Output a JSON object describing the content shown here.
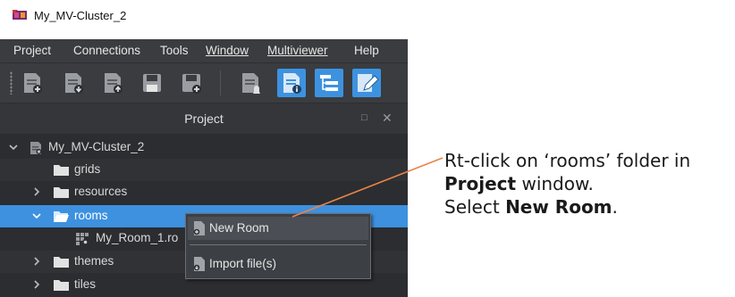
{
  "window": {
    "title": "My_MV-Cluster_2"
  },
  "menubar": {
    "items": [
      {
        "label": "Project"
      },
      {
        "label": "Connections"
      },
      {
        "label": "Tools"
      },
      {
        "label": "Window"
      },
      {
        "label": "Multiviewer"
      },
      {
        "label": "Help"
      }
    ]
  },
  "toolbar": {
    "buttons": [
      {
        "icon": "new-document-icon",
        "active": false
      },
      {
        "icon": "download-document-icon",
        "active": false
      },
      {
        "icon": "upload-document-icon",
        "active": false
      },
      {
        "icon": "save-icon",
        "active": false
      },
      {
        "icon": "save-add-icon",
        "active": false
      },
      {
        "icon": "notification-document-icon",
        "active": false
      },
      {
        "icon": "info-document-icon",
        "active": true
      },
      {
        "icon": "tree-view-icon",
        "active": true
      },
      {
        "icon": "edit-pencil-icon",
        "active": true
      }
    ]
  },
  "panel": {
    "title": "Project",
    "float_icon": "□",
    "close_icon": "✕"
  },
  "tree": {
    "rows": [
      {
        "label": "My_MV-Cluster_2",
        "type": "project",
        "expanded": true
      },
      {
        "label": "grids",
        "type": "folder"
      },
      {
        "label": "resources",
        "type": "folder",
        "expanded": false
      },
      {
        "label": "rooms",
        "type": "folder",
        "expanded": true,
        "selected": true
      },
      {
        "label": "My_Room_1.ro",
        "type": "room"
      },
      {
        "label": "themes",
        "type": "folder",
        "expanded": false
      },
      {
        "label": "tiles",
        "type": "folder",
        "expanded": false
      }
    ]
  },
  "context_menu": {
    "items": [
      {
        "label": "New Room"
      },
      {
        "label": "Import file(s)"
      }
    ]
  },
  "annotation": {
    "line1": "Rt-click on ‘rooms’ folder in",
    "line2_bold": "Project",
    "line2_rest": " window.",
    "line3_pre": "Select ",
    "line3_bold": "New Room",
    "line3_post": "."
  },
  "colors": {
    "selection": "#3d91df",
    "pointer_line": "#e8834a",
    "panel_bg": "#2b2d30"
  }
}
